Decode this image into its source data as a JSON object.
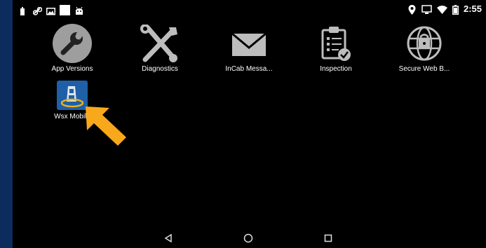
{
  "status_bar": {
    "time": "2:55",
    "left_icons": [
      "battery-small-icon",
      "link-icon",
      "image-icon",
      "square-icon",
      "android-icon"
    ],
    "right_icons": [
      "location-icon",
      "cast-icon",
      "wifi-icon",
      "battery-icon"
    ]
  },
  "apps": [
    {
      "label": "App Versions",
      "icon": "wrench-icon"
    },
    {
      "label": "Diagnostics",
      "icon": "tools-icon"
    },
    {
      "label": "InCab Messa...",
      "icon": "envelope-icon"
    },
    {
      "label": "Inspection",
      "icon": "clipboard-check-icon"
    },
    {
      "label": "Secure Web B...",
      "icon": "globe-lock-icon"
    },
    {
      "label": "Wsx Mobile",
      "icon": "wsx-app-icon"
    }
  ],
  "nav": {
    "back": "back-icon",
    "home": "home-icon",
    "recents": "recents-icon"
  },
  "colors": {
    "frame": "#0b2c5c",
    "screen": "#000000",
    "highlight_arrow": "#f7a81b"
  }
}
